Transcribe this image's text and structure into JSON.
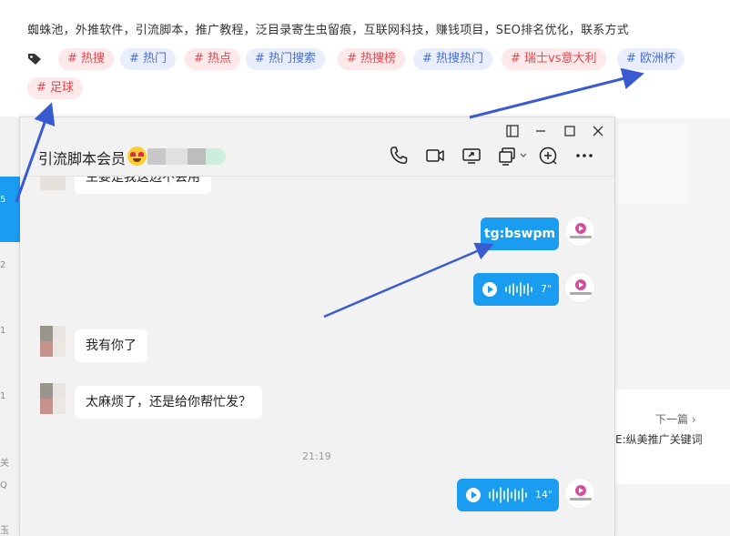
{
  "page": {
    "keywords_line": "蜘蛛池，外推软件，引流脚本，推广教程，泛目录寄生虫留痕，互联网科技，赚钱项目，SEO排名优化，联系方式",
    "tags": [
      {
        "label": "# 热搜",
        "style": "red"
      },
      {
        "label": "# 热门",
        "style": "blue"
      },
      {
        "label": "# 热点",
        "style": "red"
      },
      {
        "label": "# 热门搜索",
        "style": "blue"
      },
      {
        "label": "# 热搜榜",
        "style": "red"
      },
      {
        "label": "# 热搜热门",
        "style": "blue"
      },
      {
        "label": "# 瑞士vs意大利",
        "style": "red"
      },
      {
        "label": "# 欧洲杯",
        "style": "blue"
      },
      {
        "label": "# 足球",
        "style": "red"
      }
    ],
    "next_article_label": "下一篇 ›",
    "next_article_title": "E:纵美推广关键词",
    "left_strip_numbers": [
      "5",
      "2",
      "1",
      "1",
      "关",
      "Q",
      "玉"
    ]
  },
  "chat": {
    "title": "引流脚本会员",
    "partial_top_message": "主要是我这边不会用",
    "messages": [
      {
        "side": "right",
        "type": "text",
        "text": "tg:bswpm"
      },
      {
        "side": "right",
        "type": "voice",
        "duration": "7\""
      },
      {
        "side": "left",
        "type": "text",
        "text": "我有你了"
      },
      {
        "side": "left",
        "type": "text",
        "text": "太麻烦了，还是给你帮忙发？"
      },
      {
        "side": "right",
        "type": "voice",
        "duration": "14\""
      }
    ],
    "timestamp": "21:19"
  },
  "colors": {
    "accent": "#1a9cf0",
    "tag_red_bg": "#fde8ea",
    "tag_red_text": "#e5484d",
    "tag_blue_bg": "#e8eefb",
    "tag_blue_text": "#4a6fdc",
    "annotation_arrow": "#3a5bd0"
  },
  "icons": [
    "tag-icon",
    "sidebar-toggle-icon",
    "minimize-icon",
    "maximize-icon",
    "close-icon",
    "phone-icon",
    "video-icon",
    "screen-share-icon",
    "remote-control-icon",
    "add-icon",
    "more-icon",
    "play-icon",
    "wave-icon"
  ]
}
